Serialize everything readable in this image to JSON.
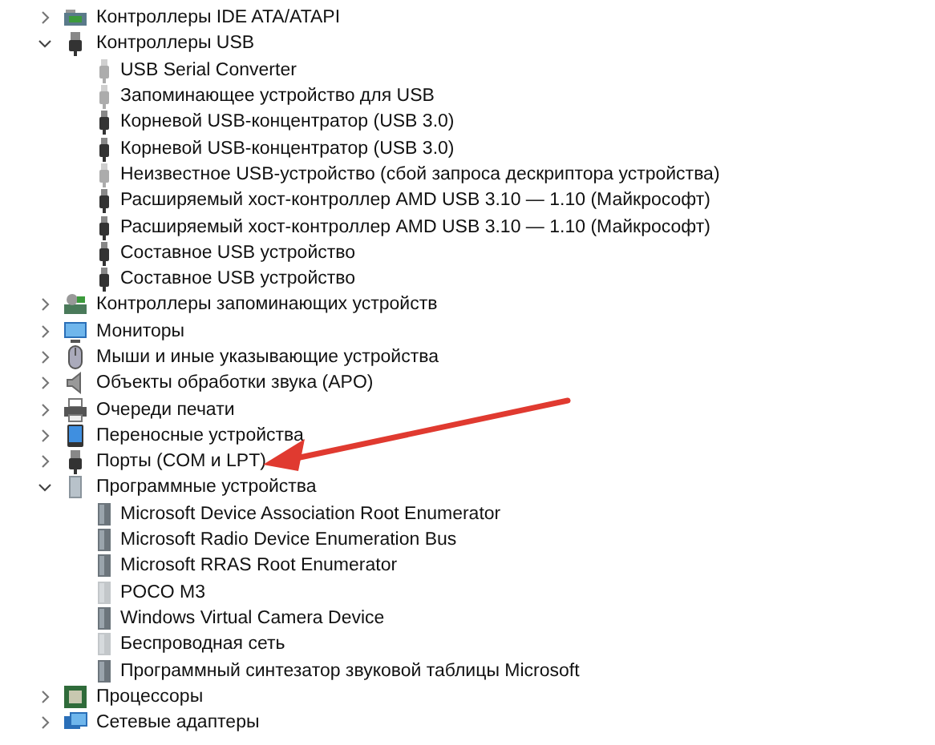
{
  "tree": [
    {
      "label": "Контроллеры IDE ATA/ATAPI",
      "kind": "ide",
      "expanded": false
    },
    {
      "label": "Контроллеры USB",
      "kind": "usb",
      "expanded": true,
      "children": [
        {
          "label": "USB Serial Converter",
          "kind": "usb",
          "hidden": true
        },
        {
          "label": "Запоминающее устройство для USB",
          "kind": "usb",
          "hidden": true
        },
        {
          "label": "Корневой USB-концентратор (USB 3.0)",
          "kind": "usb",
          "hidden": false
        },
        {
          "label": "Корневой USB-концентратор (USB 3.0)",
          "kind": "usb",
          "hidden": false
        },
        {
          "label": "Неизвестное USB-устройство (сбой запроса дескриптора устройства)",
          "kind": "usb",
          "hidden": true
        },
        {
          "label": "Расширяемый хост-контроллер AMD USB 3.10 — 1.10 (Майкрософт)",
          "kind": "usb",
          "hidden": false
        },
        {
          "label": "Расширяемый хост-контроллер AMD USB 3.10 — 1.10 (Майкрософт)",
          "kind": "usb",
          "hidden": false
        },
        {
          "label": "Составное USB устройство",
          "kind": "usb",
          "hidden": false
        },
        {
          "label": "Составное USB устройство",
          "kind": "usb",
          "hidden": false
        }
      ]
    },
    {
      "label": "Контроллеры запоминающих устройств",
      "kind": "storage",
      "expanded": false
    },
    {
      "label": "Мониторы",
      "kind": "monitor",
      "expanded": false
    },
    {
      "label": "Мыши и иные указывающие устройства",
      "kind": "mouse",
      "expanded": false
    },
    {
      "label": "Объекты обработки звука (APO)",
      "kind": "speaker",
      "expanded": false
    },
    {
      "label": "Очереди печати",
      "kind": "printer",
      "expanded": false
    },
    {
      "label": "Переносные устройства",
      "kind": "portable",
      "expanded": false
    },
    {
      "label": "Порты (COM и LPT)",
      "kind": "port",
      "expanded": false
    },
    {
      "label": "Программные устройства",
      "kind": "software",
      "expanded": true,
      "children": [
        {
          "label": "Microsoft Device Association Root Enumerator",
          "kind": "software",
          "hidden": false
        },
        {
          "label": "Microsoft Radio Device Enumeration Bus",
          "kind": "software",
          "hidden": false
        },
        {
          "label": "Microsoft RRAS Root Enumerator",
          "kind": "software",
          "hidden": false
        },
        {
          "label": "POCO M3",
          "kind": "software",
          "hidden": true
        },
        {
          "label": "Windows Virtual Camera Device",
          "kind": "software",
          "hidden": false
        },
        {
          "label": "Беспроводная сеть",
          "kind": "software",
          "hidden": true
        },
        {
          "label": "Программный синтезатор звуковой таблицы Microsoft",
          "kind": "software",
          "hidden": false
        }
      ]
    },
    {
      "label": "Процессоры",
      "kind": "cpu",
      "expanded": false
    },
    {
      "label": "Сетевые адаптеры",
      "kind": "network",
      "expanded": false
    }
  ]
}
